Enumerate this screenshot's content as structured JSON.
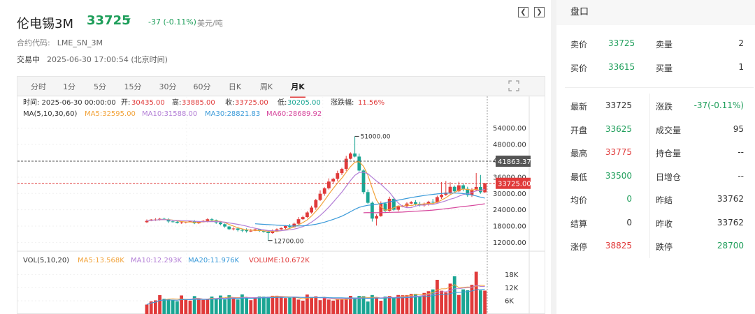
{
  "header": {
    "title": "伦电锡3M",
    "price": "33725",
    "change": "-37 (-0.11%)",
    "unit": "美元/吨",
    "contract_label": "合约代码:",
    "contract_code": "LME_SN_3M",
    "status": "交易中",
    "datetime": "2025-06-30 17:00:54 (北京时间)"
  },
  "tabs": [
    "分时",
    "1分",
    "5分",
    "15分",
    "30分",
    "60分",
    "日K",
    "周K",
    "月K"
  ],
  "active_tab": "月K",
  "info_line": {
    "time": "时间: 2025-06-30 00:00:00",
    "open_label": "开:",
    "open": "30435.00",
    "high_label": "高:",
    "high": "33885.00",
    "close_label": "收:",
    "close": "33725.00",
    "low_label": "低:",
    "low": "30205.00",
    "chg_label": "涨跌幅:",
    "chg": "11.56%"
  },
  "ma_line": {
    "label": "MA(5,10,30,60)",
    "ma5": "MA5:32595.00",
    "ma10": "MA10:31588.00",
    "ma30": "MA30:28821.83",
    "ma60": "MA60:28689.92"
  },
  "vol_line": {
    "label": "VOL(5,10,20)",
    "ma5": "MA5:13.568K",
    "ma10": "MA10:12.293K",
    "ma20": "MA20:11.976K",
    "volume": "VOLUME:10.672K"
  },
  "colors": {
    "up": "#e03a3a",
    "down": "#1aa593",
    "ma5": "#f2a33a",
    "ma10": "#b37fd6",
    "ma30": "#3a9ad9",
    "ma60": "#d6469c"
  },
  "chart_data": {
    "type": "candlestick",
    "price_axis": [
      "54000.00",
      "48000.00",
      "42000.00",
      "36000.00",
      "30000.00",
      "24000.00",
      "18000.00",
      "12000.00"
    ],
    "ylim": [
      9800,
      57000
    ],
    "crosshair_price": "41863.37",
    "last_price_label": "33725.00",
    "max_marker": "51000.00",
    "min_marker": "12700.00",
    "volume_axis": [
      "18K",
      "12K",
      "6K"
    ],
    "candles": [
      [
        19430.0,
        19930.0,
        19130.0,
        20430.0
      ],
      [
        19930.0,
        20390.0,
        19790.0,
        20570.0
      ],
      [
        20390.0,
        20420.0,
        19890.0,
        20890.0
      ],
      [
        20420.0,
        20680.0,
        20040.0,
        21010.0
      ],
      [
        20680.0,
        20490.0,
        20380.0,
        21100.0
      ],
      [
        20490.0,
        19720.0,
        19120.0,
        20910.0
      ],
      [
        19720.0,
        19590.0,
        19320.0,
        20200.0
      ],
      [
        19590.0,
        19180.0,
        18940.0,
        20140.0
      ],
      [
        19180.0,
        19340.0,
        18860.0,
        19660.0
      ],
      [
        19340.0,
        19590.0,
        18990.0,
        19630.0
      ],
      [
        19590.0,
        19810.0,
        19500.0,
        20030.0
      ],
      [
        19810.0,
        19040.0,
        18730.0,
        20200.0
      ],
      [
        19040.0,
        19480.0,
        18810.0,
        19600.0
      ],
      [
        19480.0,
        19900.0,
        19350.0,
        20240.0
      ],
      [
        19900.0,
        20520.0,
        19400.0,
        20880.0
      ],
      [
        20520.0,
        20190.0,
        19830.0,
        20930.0
      ],
      [
        20190.0,
        19330.0,
        18800.0,
        20420.0
      ],
      [
        19330.0,
        18700.0,
        18310.0,
        19840.0
      ],
      [
        18700.0,
        17840.0,
        17400.0,
        18950.0
      ],
      [
        17840.0,
        16870.0,
        16600.0,
        18080.0
      ],
      [
        16870.0,
        17120.0,
        16420.0,
        17550.0
      ],
      [
        17120.0,
        16580.0,
        16030.0,
        17610.0
      ],
      [
        16580.0,
        16460.0,
        15780.0,
        16880.0
      ],
      [
        16460.0,
        16130.0,
        15610.0,
        17180.0
      ],
      [
        16130.0,
        16280.0,
        15860.0,
        16930.0
      ],
      [
        16280.0,
        16800.0,
        16160.0,
        17070.0
      ],
      [
        16800.0,
        16210.0,
        15860.0,
        16930.0
      ],
      [
        16210.0,
        15890.0,
        15580.0,
        16430.0
      ],
      [
        15890.0,
        15450.0,
        12700.0,
        16180.0
      ],
      [
        15450.0,
        16080.0,
        15190.0,
        16790.0
      ],
      [
        16080.0,
        16800.0,
        15820.0,
        17180.0
      ],
      [
        16800.0,
        17290.0,
        16620.0,
        17530.0
      ],
      [
        17290.0,
        18090.0,
        16910.0,
        18340.0
      ],
      [
        18090.0,
        17610.0,
        17230.0,
        18790.0
      ],
      [
        17610.0,
        18880.0,
        17430.0,
        19290.0
      ],
      [
        18880.0,
        20540.0,
        18640.0,
        21310.0
      ],
      [
        20540.0,
        21320.0,
        20300.0,
        21860.0
      ],
      [
        21320.0,
        23010.0,
        20940.0,
        23460.0
      ],
      [
        23010.0,
        24810.0,
        22560.0,
        25500.0
      ],
      [
        24810.0,
        27580.0,
        24020.0,
        28030.0
      ],
      [
        27580.0,
        29890.0,
        27240.0,
        31150.0
      ],
      [
        29890.0,
        31900.0,
        29160.0,
        32290.0
      ],
      [
        31900.0,
        34380.0,
        31450.0,
        35550.0
      ],
      [
        34380.0,
        35380.0,
        33900.0,
        35760.0
      ],
      [
        35380.0,
        37470.0,
        34460.0,
        38370.0
      ],
      [
        37470.0,
        39020.0,
        36760.0,
        39440.0
      ],
      [
        39020.0,
        42750.0,
        38240.0,
        43820.0
      ],
      [
        42750.0,
        44700.0,
        42500.0,
        45110.0
      ],
      [
        44700.0,
        43560.0,
        43280.0,
        51000.0
      ],
      [
        43560.0,
        38430.0,
        38100.0,
        44650.0
      ],
      [
        38430.0,
        30500.0,
        29760.0,
        38910.0
      ],
      [
        30500.0,
        26570.0,
        26170.0,
        31460.0
      ],
      [
        26570.0,
        20760.0,
        19660.0,
        27050.0
      ],
      [
        20760.0,
        21680.0,
        18180.0,
        22310.0
      ],
      [
        21680.0,
        26360.0,
        21440.0,
        27090.0
      ],
      [
        26360.0,
        23630.0,
        23110.0,
        26790.0
      ],
      [
        23630.0,
        28040.0,
        23320.0,
        28820.0
      ],
      [
        28040.0,
        24020.0,
        23620.0,
        28780.0
      ],
      [
        24020.0,
        25220.0,
        23420.0,
        25480.0
      ],
      [
        25220.0,
        25330.0,
        24910.0,
        25760.0
      ],
      [
        25330.0,
        26300.0,
        24750.0,
        26800.0
      ],
      [
        26300.0,
        26800.0,
        25990.0,
        27190.0
      ],
      [
        26800.0,
        26160.0,
        25550.0,
        27550.0
      ],
      [
        26160.0,
        25590.0,
        25240.0,
        26920.0
      ],
      [
        25590.0,
        26010.0,
        25120.0,
        26660.0
      ],
      [
        26010.0,
        26930.0,
        25530.0,
        27310.0
      ],
      [
        26930.0,
        26740.0,
        26220.0,
        28000.0
      ],
      [
        26740.0,
        28650.0,
        26500.0,
        29200.0
      ],
      [
        28650.0,
        29510.0,
        28020.0,
        34200.0
      ],
      [
        29510.0,
        30330.0,
        29110.0,
        34600.0
      ],
      [
        30330.0,
        32450.0,
        29710.0,
        34100.0
      ],
      [
        32450.0,
        30790.0,
        30530.0,
        32940.0
      ],
      [
        30790.0,
        33000.0,
        30510.0,
        34310.0
      ],
      [
        33000.0,
        31680.0,
        30780.0,
        33750.0
      ],
      [
        31680.0,
        29400.0,
        28770.0,
        32470.0
      ],
      [
        29400.0,
        31250.0,
        28710.0,
        31980.0
      ],
      [
        31250.0,
        32400.0,
        31030.0,
        37500.0
      ],
      [
        32400.0,
        30435.0,
        29900.0,
        36800.0
      ],
      [
        30435.0,
        33725.0,
        30205.0,
        33885.0
      ]
    ],
    "volumes": [
      4290,
      5740,
      6230,
      8600,
      6920,
      6650,
      6210,
      5840,
      8450,
      6770,
      6120,
      8160,
      6530,
      6430,
      6820,
      7960,
      7190,
      8420,
      6620,
      8560,
      7100,
      6620,
      8930,
      7380,
      6300,
      7590,
      8000,
      7910,
      7900,
      8300,
      8320,
      7860,
      7270,
      7420,
      7480,
      6570,
      6100,
      8880,
      7720,
      8060,
      6310,
      7500,
      6580,
      6110,
      6680,
      6630,
      6950,
      8280,
      7120,
      8230,
      8150,
      5690,
      8650,
      7660,
      6040,
      7940,
      8210,
      7370,
      8660,
      8550,
      8630,
      9140,
      9190,
      8050,
      9610,
      10410,
      11200,
      15590,
      10620,
      9850,
      13860,
      17190,
      8680,
      11230,
      10810,
      13300,
      19270,
      10790,
      10672
    ]
  },
  "side": {
    "title": "盘口",
    "ask_label": "卖价",
    "ask": "33725",
    "ask_vol_label": "卖量",
    "ask_vol": "2",
    "bid_label": "买价",
    "bid": "33615",
    "bid_vol_label": "买量",
    "bid_vol": "1",
    "rows": [
      {
        "l1": "最新",
        "v1": "33725",
        "c1": "dark",
        "l2": "涨跌",
        "v2": "-37(-0.11%)",
        "c2": "green"
      },
      {
        "l1": "开盘",
        "v1": "33625",
        "c1": "green",
        "l2": "成交量",
        "v2": "95",
        "c2": "dark"
      },
      {
        "l1": "最高",
        "v1": "33775",
        "c1": "red",
        "l2": "持仓量",
        "v2": "--",
        "c2": "dark"
      },
      {
        "l1": "最低",
        "v1": "33500",
        "c1": "green",
        "l2": "日增仓",
        "v2": "--",
        "c2": "dark"
      },
      {
        "l1": "均价",
        "v1": "0",
        "c1": "green",
        "l2": "昨结",
        "v2": "33762",
        "c2": "dark"
      },
      {
        "l1": "结算",
        "v1": "0",
        "c1": "dark",
        "l2": "昨收",
        "v2": "33762",
        "c2": "dark"
      },
      {
        "l1": "涨停",
        "v1": "38825",
        "c1": "red",
        "l2": "跌停",
        "v2": "28700",
        "c2": "green"
      }
    ]
  }
}
